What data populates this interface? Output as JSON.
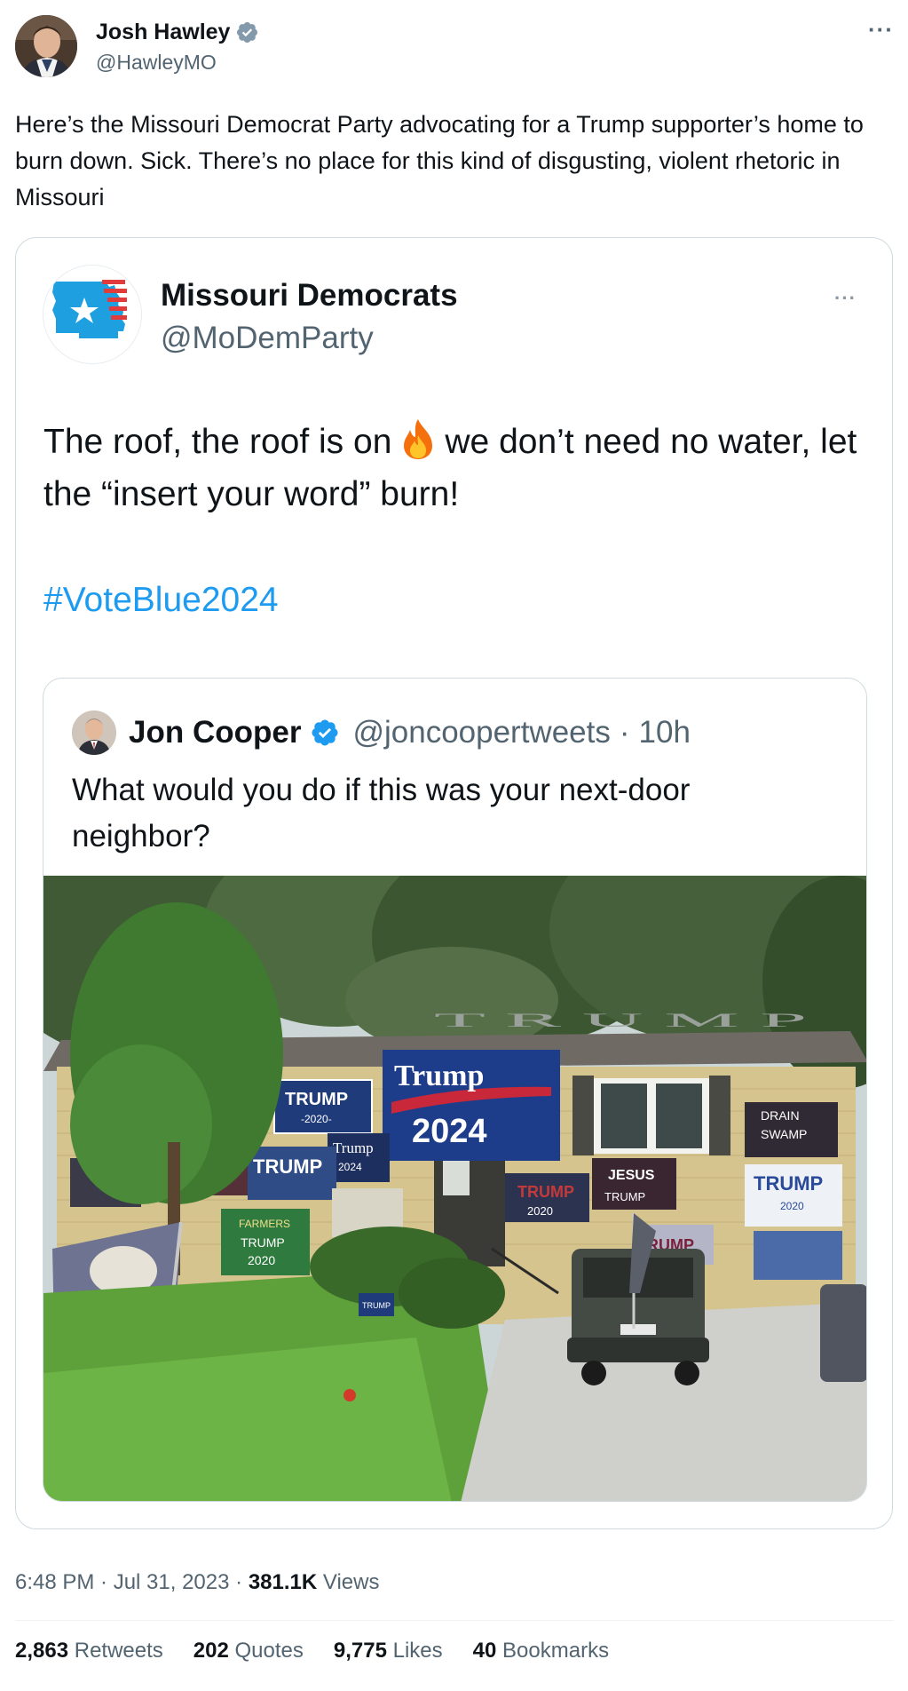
{
  "post": {
    "author": {
      "name": "Josh Hawley",
      "handle": "@HawleyMO"
    },
    "more_label": "···",
    "text": "Here’s the Missouri Democrat Party advocating for a Trump supporter’s home to burn down. Sick. There’s no place for this kind of disgusting, violent rhetoric in Missouri",
    "timestamp": "6:48 PM · Jul 31, 2023",
    "views_count": "381.1K",
    "views_label": "Views",
    "stats": {
      "retweets_count": "2,863",
      "retweets_label": "Retweets",
      "quotes_count": "202",
      "quotes_label": "Quotes",
      "likes_count": "9,775",
      "likes_label": "Likes",
      "bookmarks_count": "40",
      "bookmarks_label": "Bookmarks"
    }
  },
  "quoted": {
    "author": {
      "name": "Missouri Democrats",
      "handle": "@MoDemParty"
    },
    "more_label": "···",
    "text_before": "The roof, the roof is on",
    "text_after": "we don’t need no water, let the “insert your word” burn!",
    "hashtag": "#VoteBlue2024"
  },
  "nested": {
    "author": {
      "name": "Jon Cooper",
      "handle": "@joncoopertweets",
      "time": "10h"
    },
    "text": "What would you do if this was your next-door neighbor?",
    "image_signs": {
      "trump_2024_banner": "Trump",
      "trump_2024_year": "2024",
      "trump_2020_sign": "TRUMP",
      "trump_2020_sign_year": "-2020-",
      "trump_small": "Trump",
      "trump_small_year": "2024",
      "trump_left": "TRUMP",
      "jesus_sign": "JESUS",
      "jesus_trump": "TRUMP",
      "trump_flag_2020": "TRUMP",
      "trump_flag_2020_year": "2020",
      "drain_sign": "DRAIN",
      "swamp_sign": "SWAMP",
      "trump_right": "TRUMP",
      "trump_right_year": "2020",
      "farmers_sign": "FARMERS",
      "farmers_trump": "TRUMP",
      "farmers_year": "2020",
      "rump_sign": "RUMP",
      "yard_sign": "TRUMP",
      "roof_letters": "T R U M P"
    }
  },
  "colors": {
    "link": "#1d9bf0",
    "secondary_text": "#536471",
    "border": "#cfd9de",
    "verified_blue": "#1d9bf0",
    "verified_gray": "#829aab"
  },
  "icons": {
    "verified_gray": "verified-badge-icon",
    "verified_blue": "verified-badge-icon",
    "fire": "fire-emoji-icon",
    "more": "more-dots-icon"
  }
}
